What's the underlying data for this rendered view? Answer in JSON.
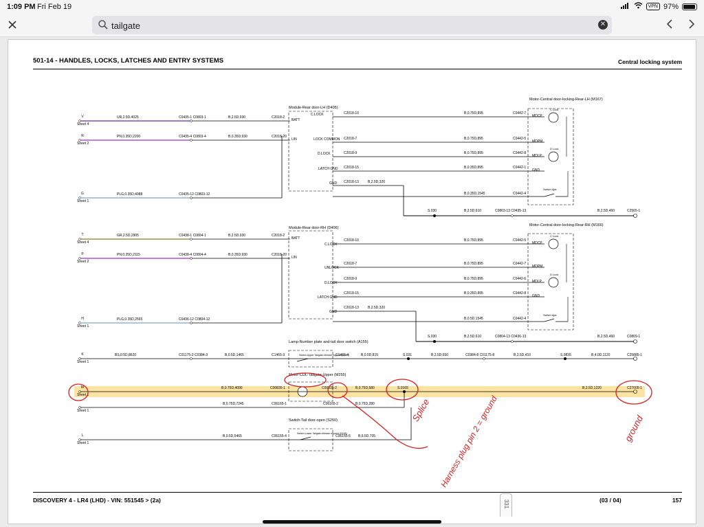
{
  "status": {
    "time": "1:09 PM",
    "date": "Fri Feb 19",
    "vpn": "VPN",
    "battery": "97%",
    "battery_level": 0.97
  },
  "toolbar": {
    "search_value": "tailgate",
    "close_icon": "close-icon",
    "prev_icon": "chevron-left-icon",
    "next_icon": "chevron-right-icon"
  },
  "header": {
    "title": "501-14 - HANDLES, LOCKS, LATCHES AND ENTRY SYSTEMS",
    "section": "Central locking system"
  },
  "footer": {
    "vehicle": "DISCOVERY 4 - LR4  (LHD) - VIN: 551545 >  (2a)",
    "page_of": "(03 / 04)",
    "page_number": "157",
    "tab_page": "331"
  },
  "diagram": {
    "lh": {
      "module": "Module-Rear door-LH (D405)",
      "motor": "Motor-Central door-locking-Rear-LH (M167)",
      "w1": {
        "code": "V",
        "sheet": "Sheet 4",
        "wire": "UR,2.5D,4025",
        "conn": "C0435-1 C0803-1",
        "wire2": "B,2.5D,930",
        "pin": "C2018-2",
        "label": "BATT"
      },
      "w2": {
        "code": "R",
        "sheet": "Sheet 2",
        "wire": "PN,0.35D,2200",
        "conn": "C0435-4 C0803-4",
        "wire2": "B,0.35D,930",
        "pin": "C2018-20",
        "label": "LIN"
      },
      "w3": {
        "code": "G",
        "sheet": "Sheet 1",
        "wire": "PLG,0.35D,4088",
        "conn": "C0435-12 C0803-12"
      },
      "out": [
        {
          "label": "C.LOCK",
          "pin": "C2018-10",
          "wire": "B,0.75D,895",
          "conn": "C0442-7",
          "mlabel": "MDCP"
        },
        {
          "label": "LOCK COMMON",
          "pin": "C2018-7",
          "wire": "B,0.75D,895",
          "conn": "C0442-5",
          "mlabel": "MDPM"
        },
        {
          "label": "D.LOCK",
          "pin": "C2018-9",
          "wire": "B,0.75D,895",
          "conn": "C0442-8",
          "mlabel": "MDLP"
        },
        {
          "label": "LATCH GND",
          "pin": "C2018-15",
          "wire": "B,0.35D,895",
          "conn": "C0442-1",
          "mlabel": "GND"
        },
        {
          "label": "GND",
          "pin": "C2018-13",
          "wire": "B,2.5D,320"
        }
      ],
      "clock": "C Lock",
      "dlock": "D Lock",
      "switch": "Switch Ajar",
      "ajar_conn": "C0442-4",
      "ajar_wire": "B,0.35D,1545",
      "gnd": {
        "splice": "S.030",
        "wire": "B,2.5D,610",
        "conn": "C0803-13 C0435-13",
        "wire2": "B,2.5D,460",
        "end": "C2565-1"
      }
    },
    "rh": {
      "module": "Module-Rear door-RH (D406)",
      "motor": "Motor-Central door-locking-Rear-RH (M166)",
      "w1": {
        "code": "T",
        "sheet": "Sheet 4",
        "wire": "GR,2.5D,2905",
        "conn": "C0438-1 C0804-1",
        "wire2": "B,2.5D,930",
        "pin": "C2018-2",
        "label": "BATT"
      },
      "w2": {
        "code": "P",
        "sheet": "Sheet 2",
        "wire": "PN,0.35D,2115",
        "conn": "C0438-4 C0804-4",
        "wire2": "B,0.35D,930",
        "pin": "C2018-20",
        "label": "LIN"
      },
      "w3": {
        "code": "H",
        "sheet": "Sheet 1",
        "wire": "PLG,0.35D,2565",
        "conn": "C0436-12 C0804-12"
      },
      "out": [
        {
          "label": "C.LOCK",
          "pin": "C2018-10",
          "wire": "B,0.75D,895",
          "conn": "C0442-5",
          "mlabel": "MDCP"
        },
        {
          "label": "UNLOCK",
          "pin": "C2018-7",
          "wire": "B,0.75D,895",
          "conn": "C0442-7",
          "mlabel": "MDPM"
        },
        {
          "label": "D.LOCK",
          "pin": "C2018-9",
          "wire": "B,0.75D,895",
          "conn": "C0442-6",
          "mlabel": "MDLP"
        },
        {
          "label": "LATCH GND",
          "pin": "C2018-15",
          "wire": "B,0.35D,895",
          "conn": "C0442-8",
          "mlabel": "GND"
        },
        {
          "label": "GND",
          "pin": "C2018-13",
          "wire": "B,2.5D,320"
        }
      ],
      "clock": "C Lock",
      "dlock": "D Lock",
      "switch": "Switch Ajar",
      "ajar_conn": "C0442-4",
      "ajar_wire": "B,0.5D,1545",
      "gnd": {
        "splice": "S.030",
        "wire": "B,2.5D,610",
        "conn": "C0804-13 C0436-13",
        "wire2": "B,2.5D,460",
        "end": "C0809-1"
      }
    },
    "lamp": {
      "title": "Lamp-Number plate and-tail door switch (A155)",
      "inner": "Switch-Upper Tailgate-release request (S423)",
      "code": "K",
      "sheet": "Sheet 1",
      "wire": "BS,0.5D,8620",
      "conn": "C01175-3 C0384-3",
      "wire2": "B,0.5D,1465",
      "pin_in": "C1465-3",
      "pin_out": "C1465-4",
      "wire3": "B,0.5D,815",
      "splice": "S.031",
      "wire4": "B,2.5D,650",
      "conn2": "C0384-8 C01175-8",
      "wire5": "B,2.5D,410",
      "splice2": "S.0835",
      "wire6": "B,4.0D,1120",
      "end": "C25885-1"
    },
    "motor_tg": {
      "title": "Motor-CDL-Tailgate-Upper (M255)",
      "code": "M",
      "sheet": "Sheet 1",
      "wire": "B,0.75D,4090",
      "pin_in": "C00835-1",
      "pin_out": "C00835-2",
      "wire2": "B,0.75D,580",
      "splice": "S.0165",
      "wire3": "B,2.5D,1220",
      "end": "C27005-1"
    },
    "tg_row2": {
      "sheet": "Sheet 1",
      "wire": "B,0.75D,7245",
      "pin": "C06165-1",
      "pin2": "C06165-2",
      "wire2": "B,0.75D,280"
    },
    "tail_switch": {
      "title": "Switch-Tail door-open (S250)",
      "inner": "Switch-Lower Tailgate-release request (S438)",
      "code": "L",
      "sheet": "Sheet 1",
      "wire": "B,0.5D,5465",
      "pin_in": "C06155-4",
      "pin_out": "C06155-5",
      "wire2": "B,6.5D,705"
    },
    "annotations": {
      "splice": "Splice",
      "ground": "ground",
      "harness": "Harness plug pin 2 = ground"
    }
  }
}
